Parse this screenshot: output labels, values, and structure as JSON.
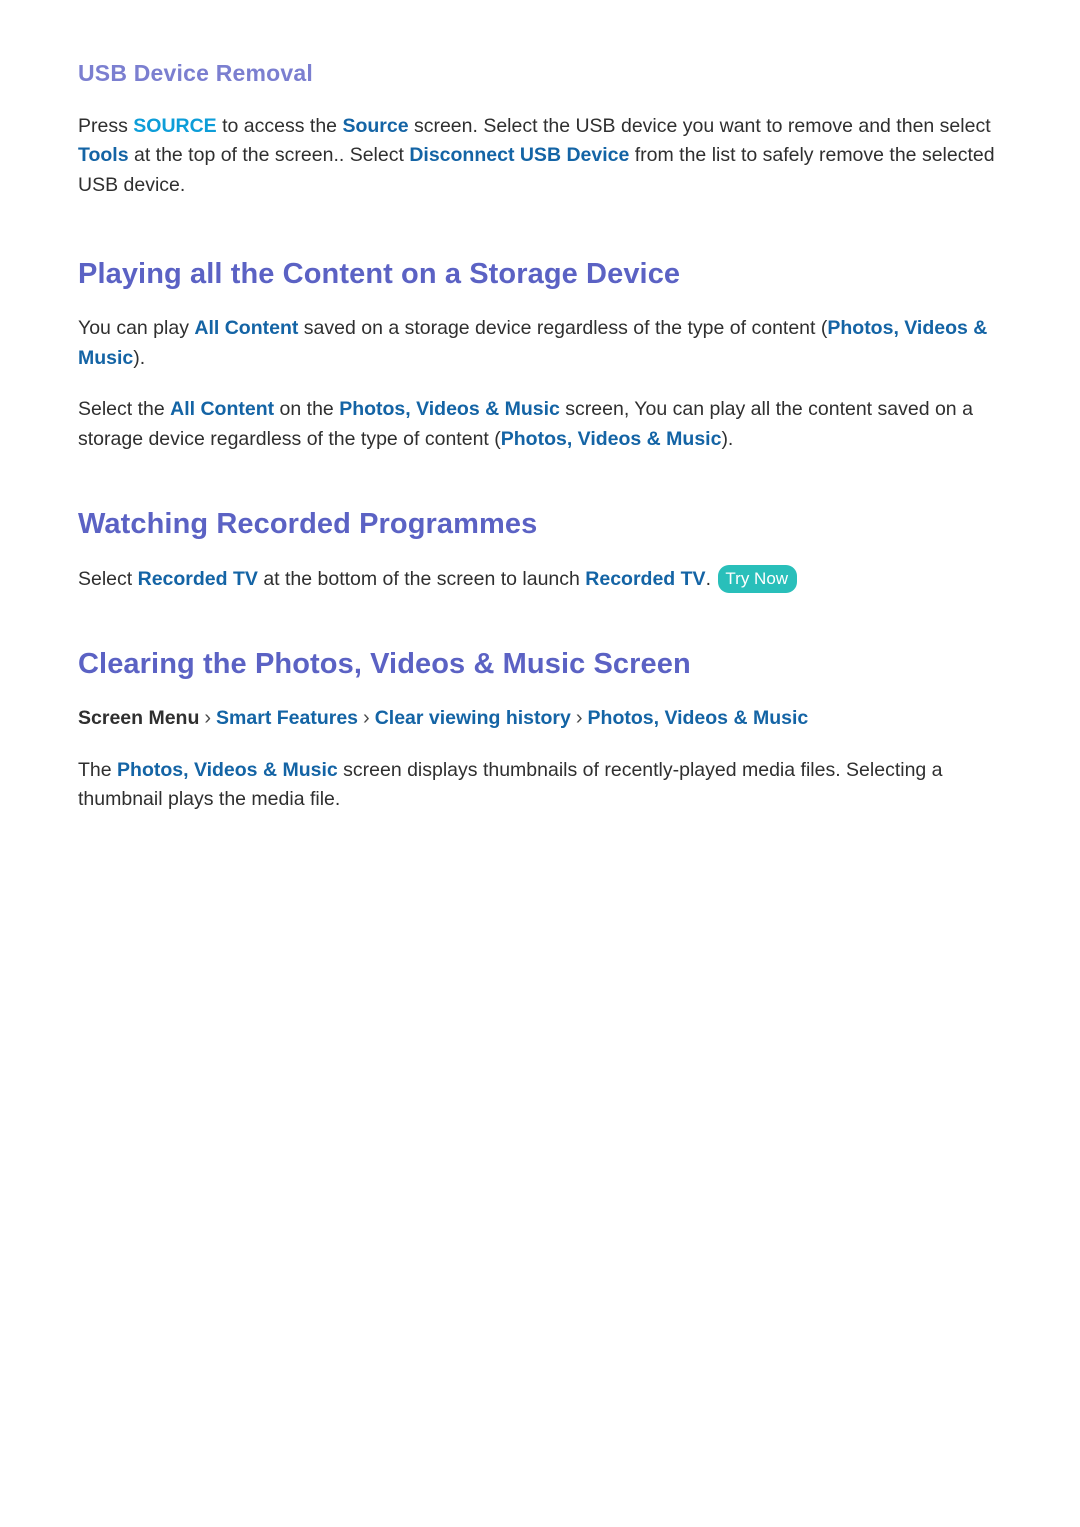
{
  "document": {
    "colors": {
      "subheading": "#7b7fd0",
      "heading": "#5b62c4",
      "keyword": "#1464a5",
      "remote_key": "#0d9dd8",
      "badge_background": "#29bfba",
      "badge_text": "#ffffff",
      "body_text": "#2f2f2f"
    }
  },
  "sections": {
    "usb_removal": {
      "heading": "USB Device Removal",
      "paragraph": {
        "t1": "Press ",
        "k1": "SOURCE",
        "t2": " to access the ",
        "k2": "Source",
        "t3": " screen. Select the USB device you want to remove and then select ",
        "k3": "Tools",
        "t4": " at the top of the screen.. Select ",
        "k4": "Disconnect USB Device",
        "t5": " from the list to safely remove the selected USB device."
      }
    },
    "play_all_content": {
      "heading": "Playing all the Content on a Storage Device",
      "paragraph1": {
        "t1": "You can play ",
        "k1": "All Content",
        "t2": " saved on a storage device regardless of the type of content (",
        "k2": "Photos, Videos & Music",
        "t3": ")."
      },
      "paragraph2": {
        "t1": "Select the ",
        "k1": "All Content",
        "t2": " on the ",
        "k2": "Photos, Videos & Music",
        "t3": " screen, You can play all the content saved on a storage device regardless of the type of content (",
        "k3": "Photos, Videos & Music",
        "t4": ")."
      }
    },
    "watching_recorded": {
      "heading": "Watching Recorded Programmes",
      "paragraph": {
        "t1": "Select ",
        "k1": "Recorded TV",
        "t2": " at the bottom of the screen to launch ",
        "k2": "Recorded TV",
        "t3": ". ",
        "badge": "Try Now"
      }
    },
    "clearing_screen": {
      "heading": "Clearing the Photos, Videos & Music Screen",
      "breadcrumb": {
        "root": "Screen Menu",
        "separator": "›",
        "items": [
          "Smart Features",
          "Clear viewing history",
          "Photos, Videos & Music"
        ]
      },
      "paragraph": {
        "t1": "The ",
        "k1": "Photos, Videos & Music",
        "t2": " screen displays thumbnails of recently-played media files. Selecting a thumbnail plays the media file."
      }
    }
  }
}
